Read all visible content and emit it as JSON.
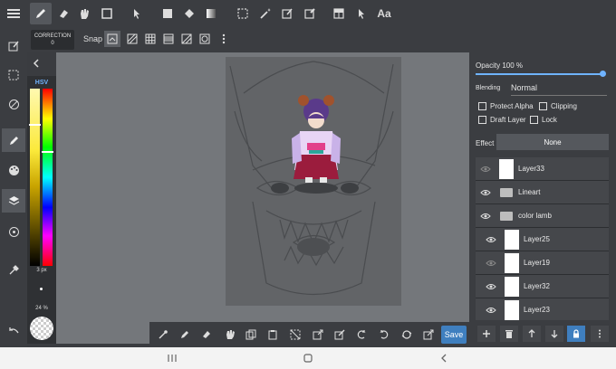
{
  "top_toolbar": {
    "text_tool_label": "Aa"
  },
  "sub_toolbar": {
    "correction_label": "CORRECTION",
    "correction_value": "0",
    "snap_label": "Snap"
  },
  "color_panel": {
    "mode_label": "HSV",
    "brush_size": "3 px",
    "brush_opacity": "24 %",
    "hue_marker_fraction": 0.35,
    "sv_marker_fraction": 0.2
  },
  "layer_panel": {
    "opacity_label": "Opacity 100 %",
    "opacity_value": 1.0,
    "blending_label": "Blending",
    "blending_value": "Normal",
    "protect_alpha_label": "Protect Alpha",
    "clipping_label": "Clipping",
    "draft_layer_label": "Draft Layer",
    "lock_label": "Lock",
    "effect_label": "Effect",
    "effect_value": "None",
    "layers": [
      {
        "name": "Layer33",
        "kind": "layer",
        "visible": false
      },
      {
        "name": "Lineart",
        "kind": "folder",
        "visible": true
      },
      {
        "name": "color lamb",
        "kind": "folder",
        "visible": true
      },
      {
        "name": "Layer25",
        "kind": "layer",
        "visible": true
      },
      {
        "name": "Layer19",
        "kind": "layer",
        "visible": false
      },
      {
        "name": "Layer32",
        "kind": "layer",
        "visible": true
      },
      {
        "name": "Layer23",
        "kind": "layer",
        "visible": true
      }
    ]
  },
  "bottom_toolbar": {
    "save_label": "Save"
  },
  "colors": {
    "accent": "#3f7fbf",
    "panel_bg": "#3b3d41",
    "canvas_bg": "#74777b"
  }
}
